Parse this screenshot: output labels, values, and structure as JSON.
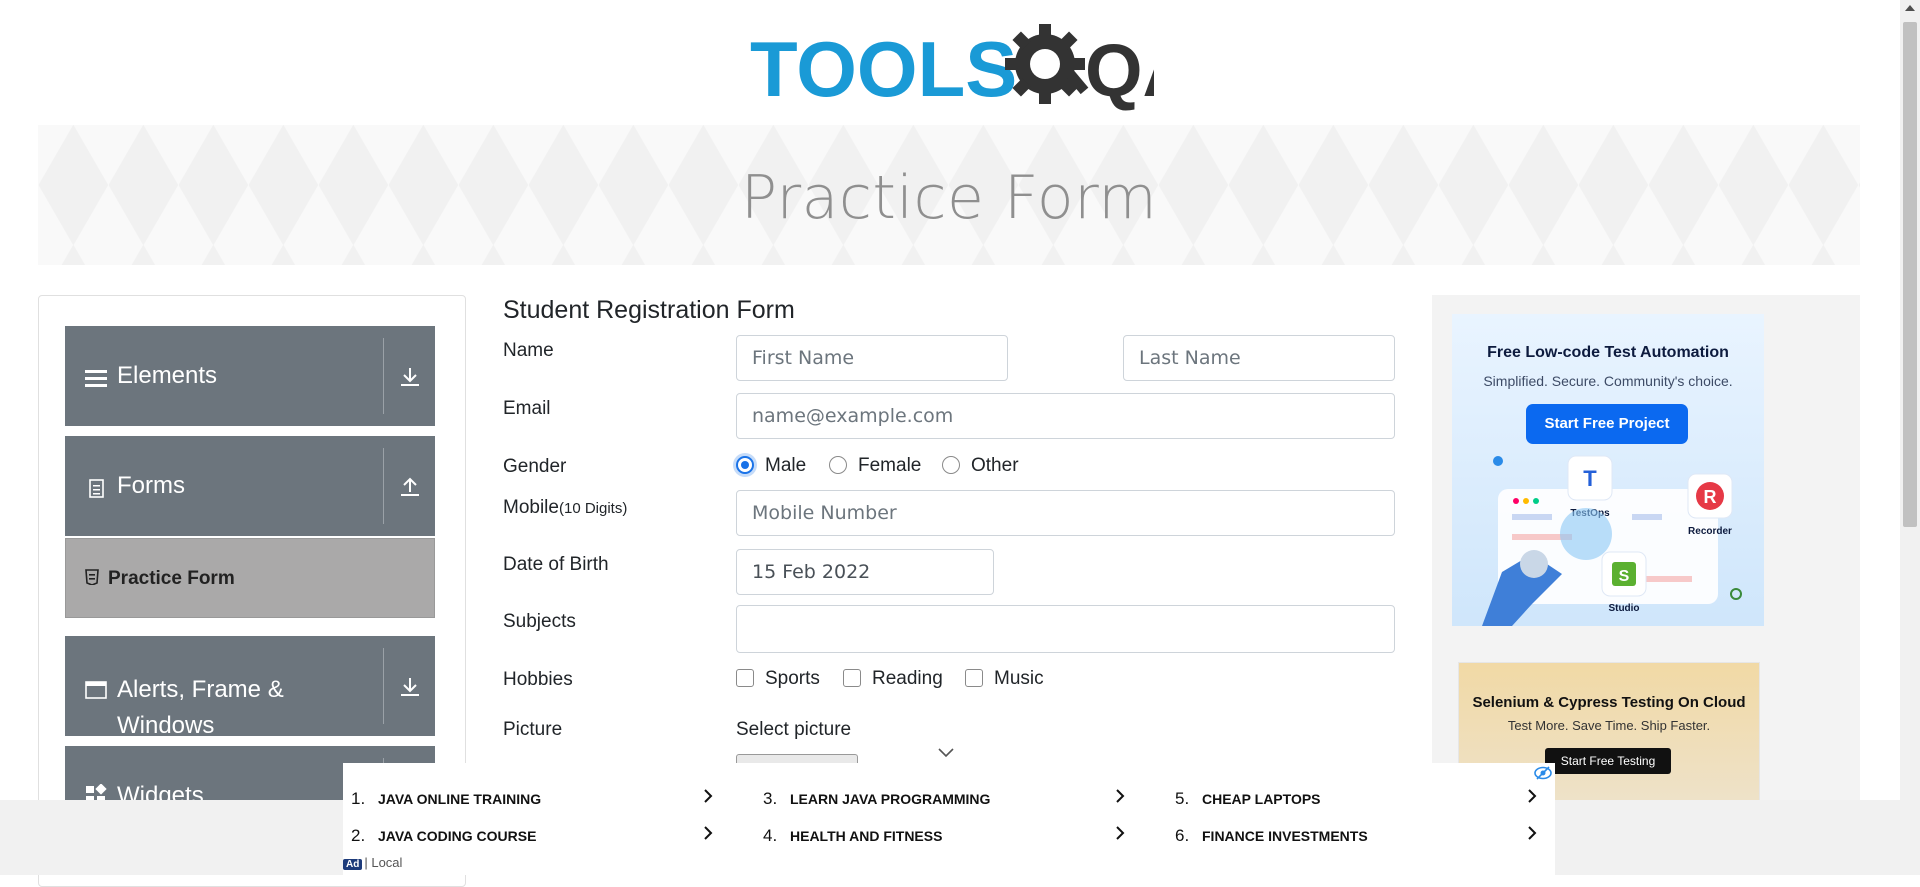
{
  "header": {
    "logo_text_primary": "TOOLS",
    "logo_text_secondary": "QA"
  },
  "banner": {
    "title": "Practice Form"
  },
  "sidebar": {
    "groups": [
      {
        "label": "Elements",
        "icon": "hamburger-icon",
        "arrow": "download-icon"
      },
      {
        "label": "Forms",
        "icon": "document-icon",
        "arrow": "upload-icon"
      },
      {
        "label_line1": "Alerts, Frame &",
        "label_line2": "Windows",
        "icon": "window-icon",
        "arrow": "download-icon"
      },
      {
        "label": "Widgets",
        "icon": "widgets-icon"
      }
    ],
    "active_item": {
      "label": "Practice Form",
      "icon": "badge-icon"
    }
  },
  "form": {
    "title": "Student Registration Form",
    "name": {
      "label": "Name",
      "first_placeholder": "First Name",
      "last_placeholder": "Last Name"
    },
    "email": {
      "label": "Email",
      "placeholder": "name@example.com"
    },
    "gender": {
      "label": "Gender",
      "options": [
        "Male",
        "Female",
        "Other"
      ],
      "selected": "Male"
    },
    "mobile": {
      "label": "Mobile",
      "hint": "(10 Digits)",
      "placeholder": "Mobile Number"
    },
    "dob": {
      "label": "Date of Birth",
      "value": "15 Feb 2022"
    },
    "subjects": {
      "label": "Subjects",
      "value": ""
    },
    "hobbies": {
      "label": "Hobbies",
      "options": [
        "Sports",
        "Reading",
        "Music"
      ]
    },
    "picture": {
      "label": "Picture",
      "button_label": "Select picture"
    }
  },
  "ads": {
    "right_top": {
      "title": "Free Low-code Test Automation",
      "subtitle": "Simplified. Secure. Community's choice.",
      "button": "Start Free Project",
      "labels": [
        "TestOps",
        "Recorder",
        "Studio"
      ]
    },
    "right_bottom": {
      "title": "Selenium & Cypress Testing On Cloud",
      "subtitle": "Test More. Save Time. Ship Faster.",
      "button": "Start Free Testing"
    },
    "bottom_links": [
      {
        "num": "1.",
        "text": "JAVA ONLINE TRAINING"
      },
      {
        "num": "3.",
        "text": "LEARN JAVA PROGRAMMING"
      },
      {
        "num": "5.",
        "text": "CHEAP LAPTOPS"
      },
      {
        "num": "2.",
        "text": "JAVA CODING COURSE"
      },
      {
        "num": "4.",
        "text": "HEALTH AND FITNESS"
      },
      {
        "num": "6.",
        "text": "FINANCE INVESTMENTS"
      }
    ],
    "footer_badge": "Ad",
    "footer_text": "| Local"
  },
  "colors": {
    "brand_blue": "#1a9ad6",
    "brand_dark": "#333333",
    "sidebar_bg": "#6c757d",
    "active_item_bg": "#aaa9a9",
    "radio_accent": "#1a73e8"
  }
}
